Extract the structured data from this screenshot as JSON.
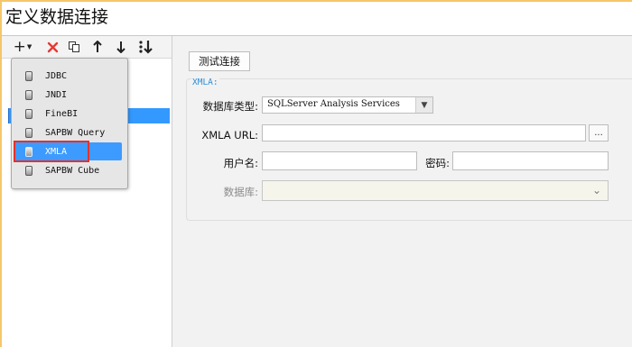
{
  "window": {
    "title": "定义数据连接"
  },
  "toolbar": {
    "add_icon": "plus-icon",
    "add_label": "+",
    "delete_icon": "delete-x-icon",
    "copy_icon": "copy-icon",
    "up_icon": "arrow-up-icon",
    "down_icon": "arrow-down-icon",
    "sort_icon": "sort-icon"
  },
  "menu": {
    "items": [
      {
        "label": "JDBC"
      },
      {
        "label": "JNDI"
      },
      {
        "label": "FineBI"
      },
      {
        "label": "SAPBW Query"
      },
      {
        "label": "XMLA"
      },
      {
        "label": "SAPBW Cube"
      }
    ],
    "active_index": 4
  },
  "form": {
    "test_button": "测试连接",
    "group_title": "XMLA:",
    "db_type_label": "数据库类型:",
    "db_type_value": "SQLServer Analysis Services",
    "url_label": "XMLA URL:",
    "url_value": "",
    "browse_button": "...",
    "username_label": "用户名:",
    "username_value": "",
    "password_label": "密码:",
    "password_value": "",
    "database_label": "数据库:",
    "database_value": ""
  },
  "colors": {
    "accent": "#3d9bff",
    "highlight_box": "#e4312b",
    "legend": "#2f8fd8",
    "delete_icon": "#e53935"
  }
}
